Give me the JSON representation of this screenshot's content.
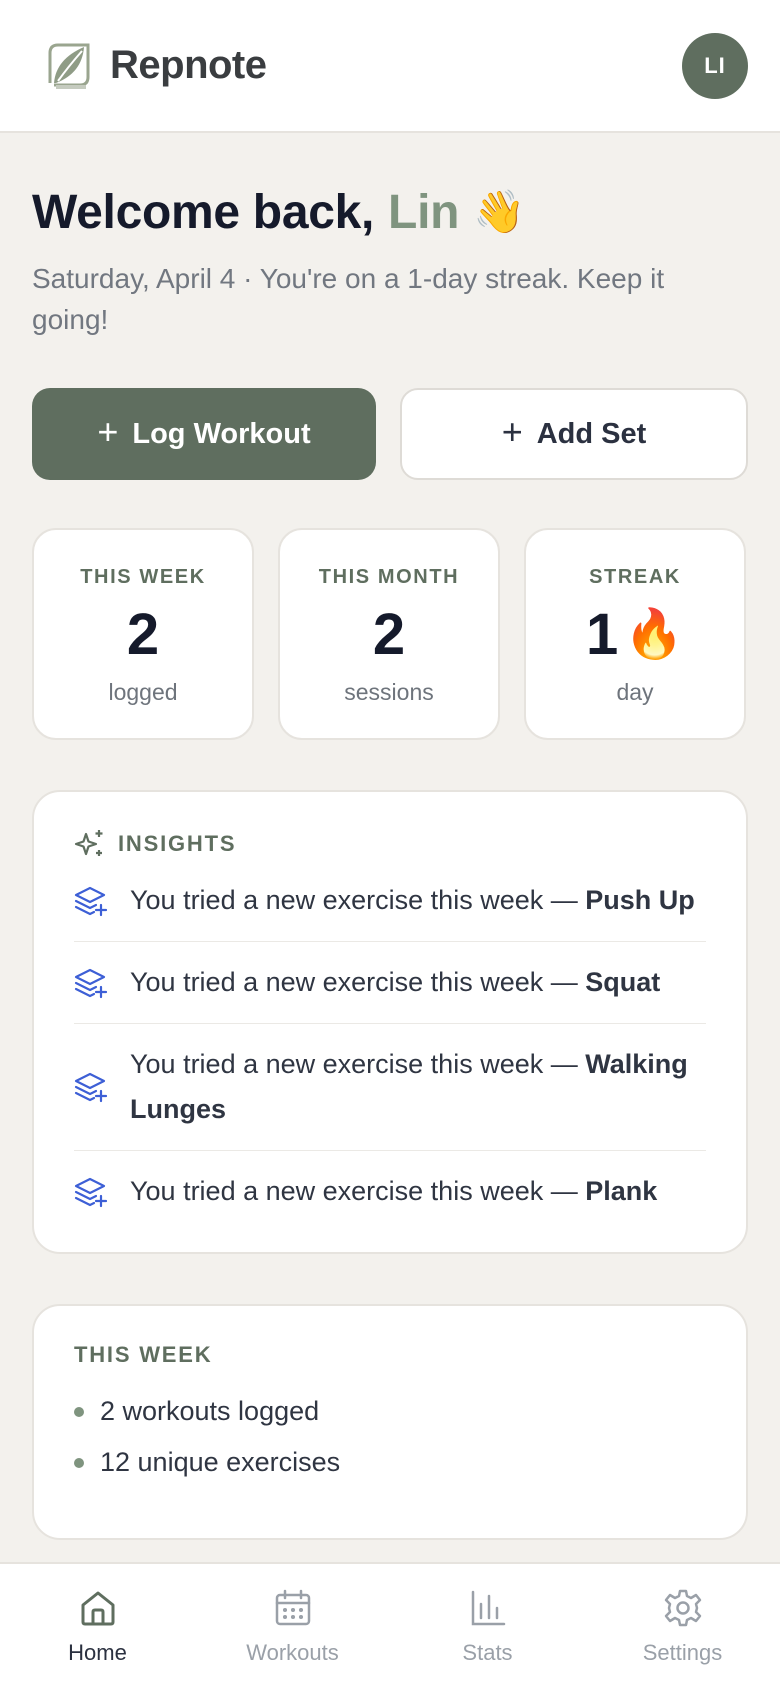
{
  "header": {
    "brand_name": "Repnote",
    "avatar_initials": "LI"
  },
  "welcome": {
    "prefix": "Welcome back,",
    "name": "Lin",
    "emoji": "👋",
    "subtitle": "Saturday, April 4 · You're on a 1-day streak. Keep it going!"
  },
  "actions": {
    "log_workout": "Log Workout",
    "add_set": "Add Set"
  },
  "stats": [
    {
      "label": "THIS WEEK",
      "value": "2",
      "sub": "logged"
    },
    {
      "label": "THIS MONTH",
      "value": "2",
      "sub": "sessions"
    },
    {
      "label": "STREAK",
      "value": "1",
      "emoji": "🔥",
      "sub": "day"
    }
  ],
  "insights": {
    "title": "INSIGHTS",
    "items": [
      {
        "text": "You tried a new exercise this week —",
        "exercise": "Push Up"
      },
      {
        "text": "You tried a new exercise this week —",
        "exercise": "Squat"
      },
      {
        "text": "You tried a new exercise this week —",
        "exercise": "Walking Lunges"
      },
      {
        "text": "You tried a new exercise this week —",
        "exercise": "Plank"
      }
    ]
  },
  "this_week": {
    "title": "THIS WEEK",
    "items": [
      "2 workouts logged",
      "12 unique exercises"
    ]
  },
  "nav": [
    {
      "label": "Home"
    },
    {
      "label": "Workouts"
    },
    {
      "label": "Stats"
    },
    {
      "label": "Settings"
    }
  ],
  "colors": {
    "accent": "#5f6e5f",
    "accent_light": "#7f947f",
    "insight_icon": "#3d5fd6",
    "background": "#f3f1ed"
  }
}
